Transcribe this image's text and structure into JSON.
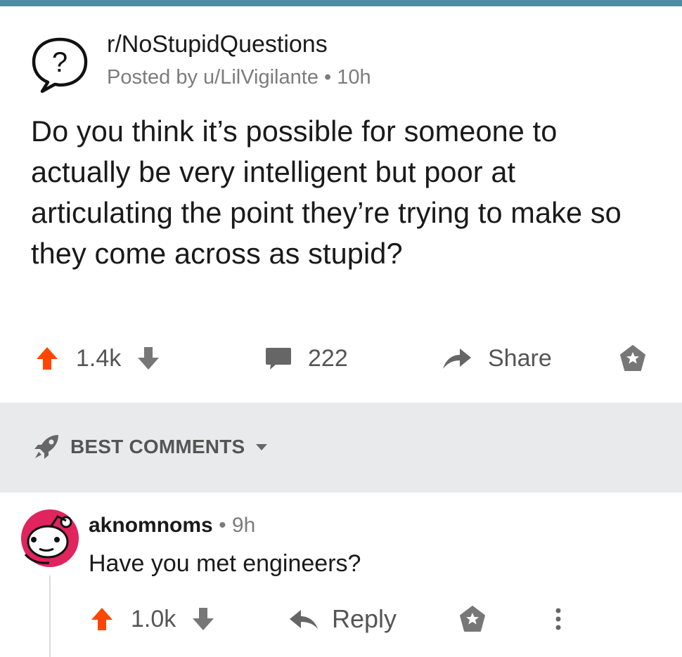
{
  "colors": {
    "accent_bar": "#4f8ba3",
    "upvote": "#ff4500",
    "muted": "#7c7c7c",
    "band": "#e9eaeb"
  },
  "post": {
    "subreddit": "r/NoStupidQuestions",
    "posted_by": "Posted by u/LilVigilante",
    "age": "10h",
    "title": "Do you think it’s possible for someone to actually be very intelligent but poor at articulating the point they’re trying to make so they come across as stupid?",
    "upvotes": "1.4k",
    "comments": "222",
    "share_label": "Share"
  },
  "sort": {
    "label": "BEST COMMENTS",
    "icon": "rocket-icon"
  },
  "comment": {
    "author": "aknomnoms",
    "age": "9h",
    "body": "Have you met engineers?",
    "upvotes": "1.0k",
    "reply_label": "Reply"
  }
}
